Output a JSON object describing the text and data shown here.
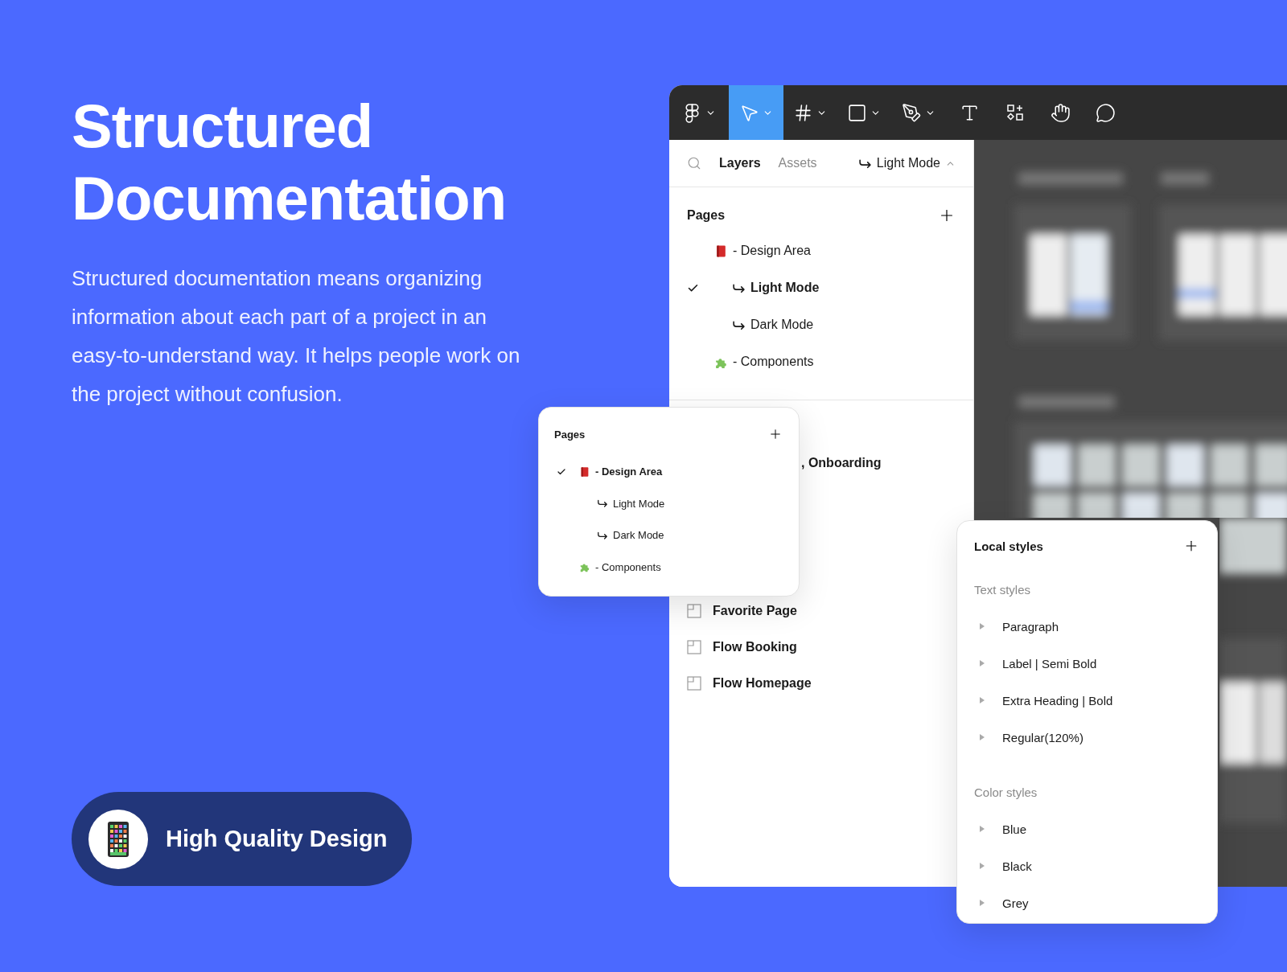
{
  "hero": {
    "title": "Structured Documentation",
    "description": "Structured documentation means organizing information about each part of a project in an easy-to-understand way. It helps people work on the project without confusion."
  },
  "badge": {
    "label": "High Quality Design"
  },
  "toolbar": {
    "tools": [
      {
        "kind": "figma-menu",
        "selected": false,
        "dropdown": true
      },
      {
        "kind": "move",
        "selected": true,
        "dropdown": true
      },
      {
        "kind": "frame",
        "selected": false,
        "dropdown": true
      },
      {
        "kind": "shape",
        "selected": false,
        "dropdown": true
      },
      {
        "kind": "pen",
        "selected": false,
        "dropdown": true
      },
      {
        "kind": "text",
        "selected": false,
        "dropdown": false
      },
      {
        "kind": "resources",
        "selected": false,
        "dropdown": false
      },
      {
        "kind": "hand",
        "selected": false,
        "dropdown": false
      },
      {
        "kind": "comment",
        "selected": false,
        "dropdown": false
      }
    ]
  },
  "panel": {
    "tabs": [
      {
        "label": "Layers",
        "selected": true
      },
      {
        "label": "Assets",
        "selected": false
      }
    ],
    "page_selector": "Light Mode",
    "pages": {
      "title": "Pages",
      "items": [
        {
          "kind": "book",
          "label": "- Design Area",
          "selected": false
        },
        {
          "kind": "subpage",
          "label": "Light Mode",
          "selected": true
        },
        {
          "kind": "subpage",
          "label": "Dark Mode",
          "selected": false
        },
        {
          "kind": "puzzle",
          "label": "- Components",
          "selected": false
        }
      ]
    },
    "layers": [
      {
        "kind": "partial",
        "label": ", Onboarding"
      },
      {
        "kind": "frame",
        "label": "Favorite Page"
      },
      {
        "kind": "frame",
        "label": "Flow Booking"
      },
      {
        "kind": "frame",
        "label": "Flow Homepage"
      }
    ]
  },
  "pages_popover": {
    "title": "Pages",
    "items": [
      {
        "kind": "book",
        "label": "- Design Area",
        "selected": true
      },
      {
        "kind": "subpage",
        "label": "Light Mode",
        "selected": false
      },
      {
        "kind": "subpage",
        "label": "Dark Mode",
        "selected": false
      },
      {
        "kind": "puzzle",
        "label": "- Components",
        "selected": false
      }
    ]
  },
  "local_styles": {
    "title": "Local styles",
    "groups": [
      {
        "title": "Text styles",
        "items": [
          "Paragraph",
          "Label | Semi Bold",
          "Extra Heading | Bold",
          "Regular(120%)"
        ]
      },
      {
        "title": "Color styles",
        "items": [
          "Blue",
          "Black",
          "Grey"
        ]
      }
    ]
  }
}
